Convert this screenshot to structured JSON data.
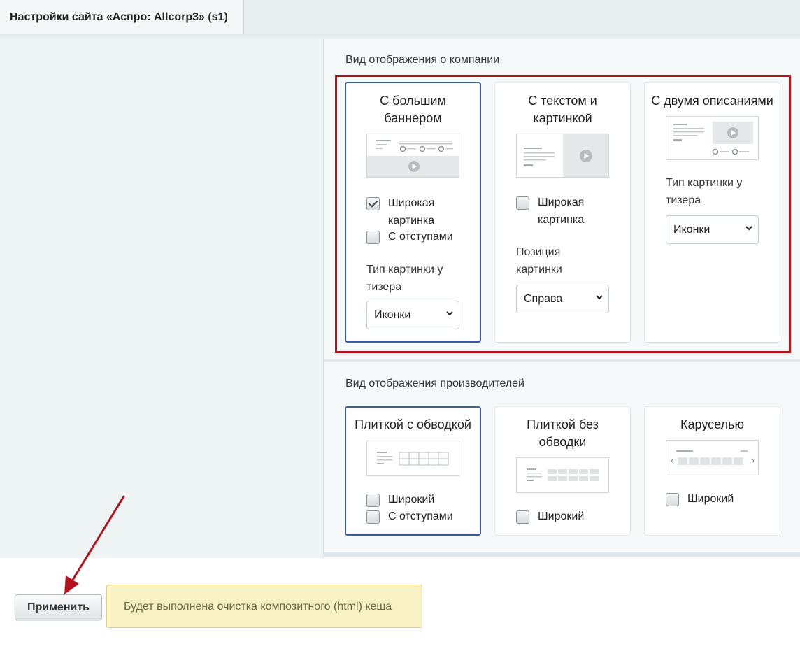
{
  "tab": {
    "title": "Настройки сайта «Аспро: Allcorp3» (s1)"
  },
  "company_section": {
    "title": "Вид отображения о компании",
    "cards": [
      {
        "title_lines": [
          "С большим",
          "баннером"
        ],
        "selected": true,
        "checkboxes": [
          {
            "label_lines": [
              "Широкая",
              "картинка"
            ],
            "checked": true
          },
          {
            "label_lines": [
              "С отступами"
            ],
            "checked": false
          }
        ],
        "field_label_lines": [
          "Тип картинки у",
          "тизера"
        ],
        "select_value": "Иконки"
      },
      {
        "title_lines": [
          "С текстом и",
          "картинкой"
        ],
        "selected": false,
        "checkboxes": [
          {
            "label_lines": [
              "Широкая",
              "картинка"
            ],
            "checked": false
          }
        ],
        "field_label_lines": [
          "Позиция",
          "картинки"
        ],
        "select_value": "Справа"
      },
      {
        "title_lines": [
          "С двумя описаниями"
        ],
        "selected": false,
        "checkboxes": [],
        "field_label_lines": [
          "Тип картинки у",
          "тизера"
        ],
        "select_value": "Иконки"
      }
    ]
  },
  "brands_section": {
    "title": "Вид отображения производителей",
    "cards": [
      {
        "title_lines": [
          "Плиткой с обводкой"
        ],
        "selected": true,
        "checkboxes": [
          {
            "label_lines": [
              "Широкий"
            ],
            "checked": false
          },
          {
            "label_lines": [
              "С отступами"
            ],
            "checked": false
          }
        ]
      },
      {
        "title_lines": [
          "Плиткой без",
          "обводки"
        ],
        "selected": false,
        "checkboxes": [
          {
            "label_lines": [
              "Широкий"
            ],
            "checked": false
          }
        ]
      },
      {
        "title_lines": [
          "Каруселью"
        ],
        "selected": false,
        "checkboxes": [
          {
            "label_lines": [
              "Широкий"
            ],
            "checked": false
          }
        ]
      }
    ]
  },
  "footer": {
    "apply_label": "Применить",
    "notice": "Будет выполнена очистка композитного (html) кеша"
  },
  "colors": {
    "selected_border": "#3b5aa8",
    "highlight_frame": "#b5121b",
    "notice_bg": "#f8f1c4"
  }
}
